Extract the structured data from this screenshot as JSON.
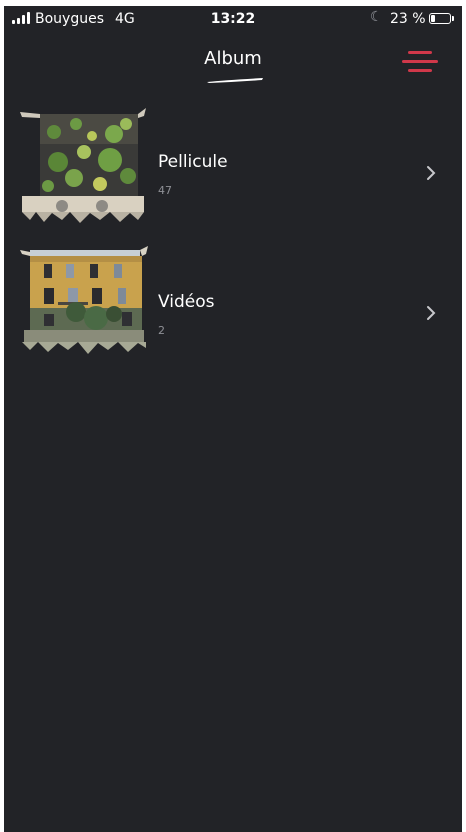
{
  "status_bar": {
    "carrier": "Bouygues",
    "network": "4G",
    "time": "13:22",
    "battery_percent": "23 %",
    "battery_level": 0.23,
    "moon_icon": "☾"
  },
  "header": {
    "title": "Album",
    "menu_icon": "hamburger-menu-icon",
    "accent_color": "#d0384a"
  },
  "albums": [
    {
      "name": "Pellicule",
      "count": "47",
      "thumbnail": "lily-pads-photo",
      "chevron": "›"
    },
    {
      "name": "Vidéos",
      "count": "2",
      "thumbnail": "building-facade-photo",
      "chevron": "›"
    }
  ],
  "colors": {
    "background": "#222327",
    "text": "#ffffff",
    "muted_text": "#8f9096"
  }
}
